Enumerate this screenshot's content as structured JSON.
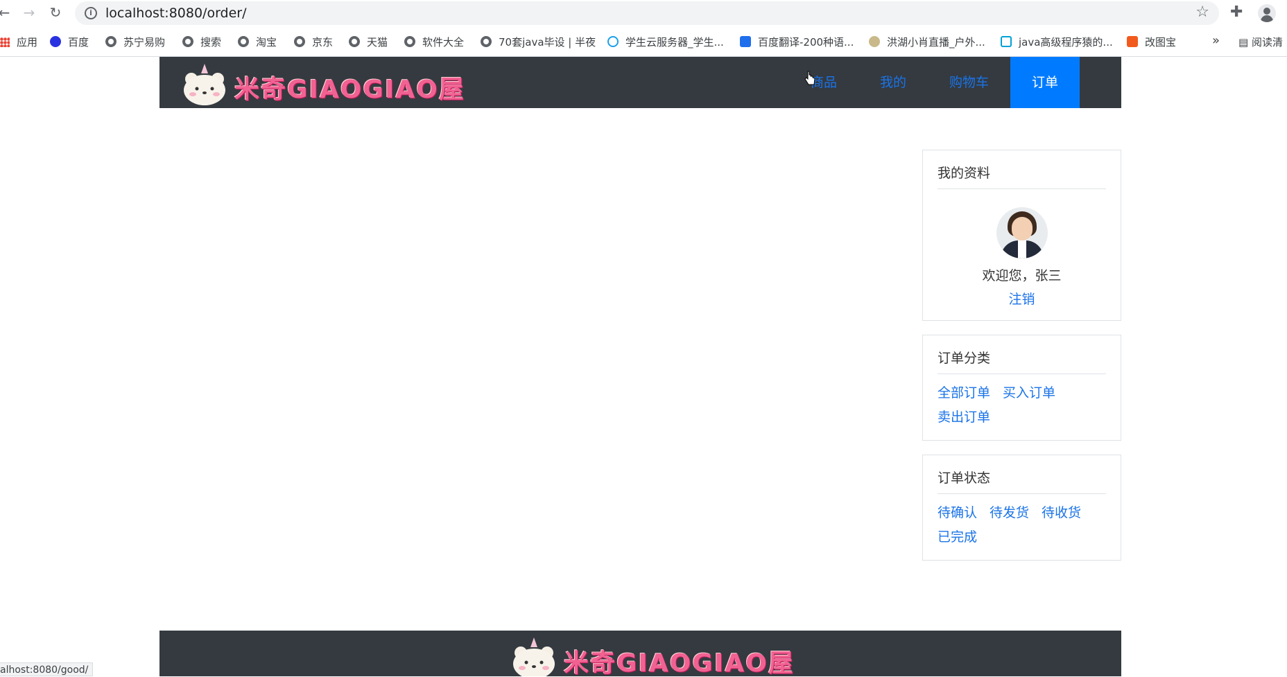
{
  "browser": {
    "url": "localhost:8080/order/",
    "bookmarks": [
      {
        "label": "应用",
        "icon": "apps-icon"
      },
      {
        "label": "百度",
        "icon": "baidu-icon"
      },
      {
        "label": "苏宁易购",
        "icon": "globe-icon"
      },
      {
        "label": "搜索",
        "icon": "globe-icon"
      },
      {
        "label": "淘宝",
        "icon": "globe-icon"
      },
      {
        "label": "京东",
        "icon": "globe-icon"
      },
      {
        "label": "天猫",
        "icon": "globe-icon"
      },
      {
        "label": "软件大全",
        "icon": "globe-icon"
      },
      {
        "label": "70套java毕设 | 半夜",
        "icon": "globe-icon"
      },
      {
        "label": "学生云服务器_学生...",
        "icon": "cloud-icon"
      },
      {
        "label": "百度翻译-200种语...",
        "icon": "translate-icon"
      },
      {
        "label": "洪湖小肖直播_户外...",
        "icon": "live-icon"
      },
      {
        "label": "java高级程序猿的...",
        "icon": "bilibili-icon"
      },
      {
        "label": "改图宝",
        "icon": "image-edit-icon"
      }
    ],
    "more": "»",
    "reading_list": "阅读清",
    "status_url": "alhost:8080/good/"
  },
  "header": {
    "logo_text": "米奇GIAOGIAO屋",
    "nav": [
      {
        "label": "商品",
        "active": false
      },
      {
        "label": "我的",
        "active": false
      },
      {
        "label": "购物车",
        "active": false
      },
      {
        "label": "订单",
        "active": true
      }
    ]
  },
  "sidebar": {
    "profile": {
      "title": "我的资料",
      "welcome": "欢迎您，张三",
      "logout": "注销"
    },
    "order_category": {
      "title": "订单分类",
      "links": [
        "全部订单",
        "买入订单",
        "卖出订单"
      ]
    },
    "order_status": {
      "title": "订单状态",
      "links": [
        "待确认",
        "待发货",
        "待收货",
        "已完成"
      ]
    }
  },
  "footer": {
    "logo_text": "米奇GIAOGIAO屋"
  },
  "colors": {
    "header_bg": "#343a40",
    "link": "#1a73e8",
    "active_nav": "#007bff",
    "logo_pink": "#f06292"
  }
}
